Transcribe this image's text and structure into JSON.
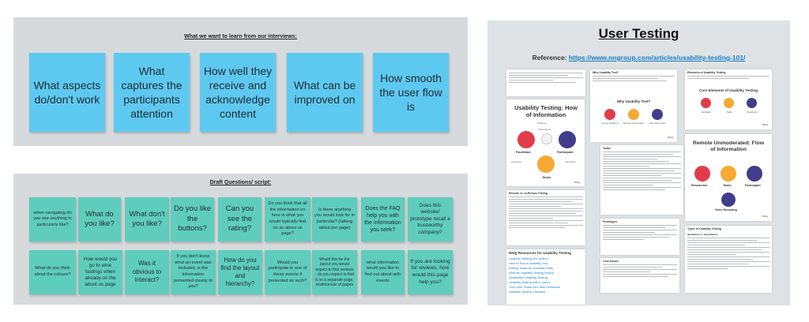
{
  "left_top_frame": {
    "title": "What we want to learn from our interviews:",
    "notes": [
      "What aspects do/don't work",
      "What captures the participants attention",
      "How well they receive and acknowledge content",
      "What can be improved on",
      "How smooth the user flow is"
    ]
  },
  "left_bottom_frame": {
    "title": "Draft Questions/ script:",
    "row1": [
      "when navigating do you see anything in particularly like?",
      "What do you like?",
      "What don't you like?",
      "Do you like the buttons?",
      "Can you see the rating?",
      "Do you think that all the information on here is what you would typically find on an about us page?",
      "Is there anything you would look for in particular? (talking about per page)",
      "Does the FAQ help you with the information you seek?",
      "Does this website/ prototype recall a trustworthy company?"
    ],
    "row2": [
      "What do you think about the colours?",
      "How would you go to wine tastings when already on the about us page",
      "Was it obvious to interact?",
      "If you don't know what an event was included, is the information presented clearly to you?",
      "How do you find the layout and hierarchy?",
      "Would you participate in one of these events if presented as such?",
      "Would this be the layout you would expect to find reviews - do you expect to find it on a separate page, testimonials of pages",
      "what information would you like to find out about with events",
      "If you are looking for reviews, how would this page help you?"
    ]
  },
  "right_frame": {
    "title": "User Testing",
    "reference_label": "Reference:",
    "reference_url": "https://www.nngroup.com/articles/usability-testing-101/",
    "card_flow": {
      "title": "Usability Testing: How of Information",
      "facilitator": "Facilitator",
      "participant": "Participant",
      "tasks": "Tasks",
      "observe": "Observe",
      "think_aloud": "Think aloud",
      "questions": "Questions",
      "interaction": "Interaction",
      "brand": "NN/g"
    },
    "card_why": {
      "title": "Why Usability Test?",
      "sub": "Why Usability Test?",
      "c1": "Uncover Problems",
      "c2": "Discover Opportunities",
      "c3": "Learn About Users",
      "brand": "NN/g"
    },
    "card_elements": {
      "title": "Elements of Usability Testing",
      "sub": "Core Elements of Usability Testing",
      "c1": "Facilitator",
      "c2": "Tasks",
      "c3": "Participant",
      "brand": "NN/g"
    },
    "card_remote": {
      "title": "Remote Unmoderated: Flow of Information",
      "resource": "Researcher",
      "tasks": "Tasks",
      "participant": "Participant",
      "video": "Video Recording",
      "brand": "NN/g"
    },
    "doc_tasks_title": "Tasks",
    "doc_types_title": "Types of Usability Testing",
    "doc_types_sub": "Qualitative vs. Quantitative",
    "doc_intro_title": "Remote vs. In-Person Testing",
    "doc_prototypes_title": "Prototypes",
    "doc_costs_title": "Cost Issues",
    "resources": {
      "title": "NN/g Resources for Usability Testing",
      "items": [
        "Usability Testing 101 (video)",
        "How to Run a Usability Test",
        "Writing Tasks for Usability Tests",
        "Remote Usability Testing (video)",
        "Qualitative Usability Testing",
        "Usability Testing with 5 Users",
        "Turn User Goals into Task Scenarios",
        "Usability Testing Checklist"
      ]
    }
  },
  "colors": {
    "frame_bg": "#d6dadd",
    "blue_note": "#5ec9f0",
    "green_note": "#5fcdbb",
    "link": "#1b7fc4",
    "red_icon": "#e23c4a",
    "orange_icon": "#f7a933",
    "purple_icon": "#413d8c"
  }
}
